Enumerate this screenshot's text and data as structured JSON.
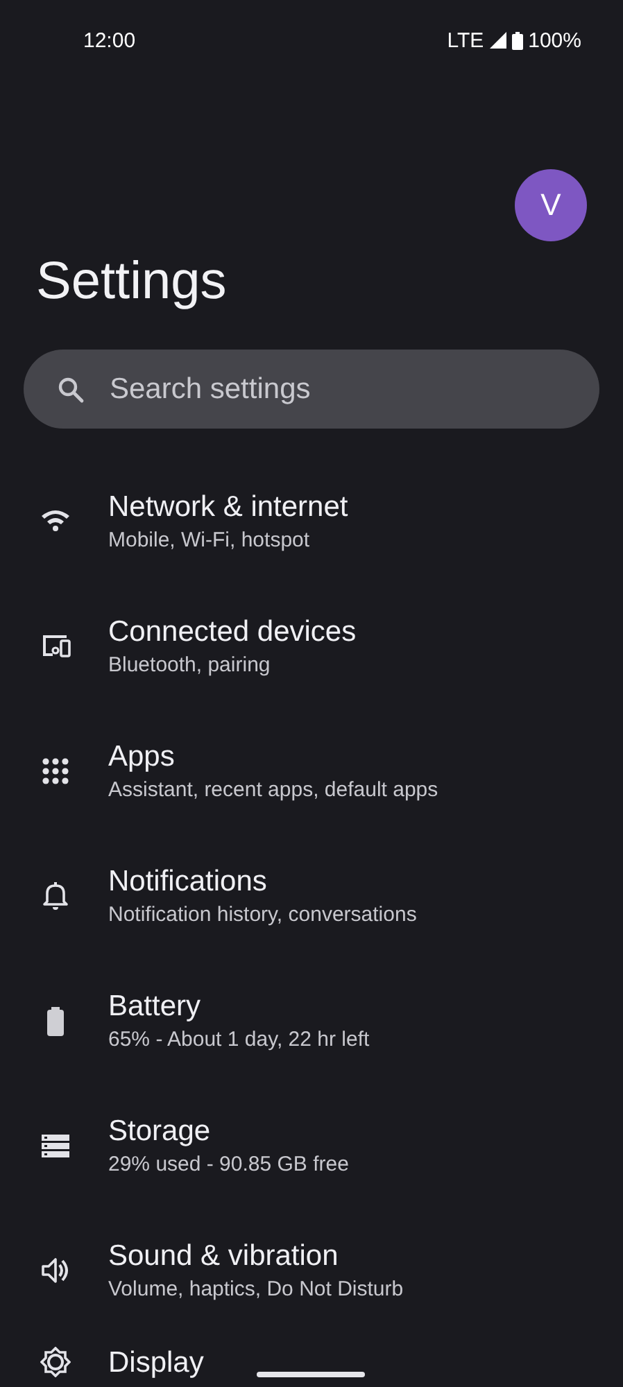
{
  "status_bar": {
    "time": "12:00",
    "network": "LTE",
    "battery": "100%"
  },
  "avatar": {
    "initial": "V",
    "color": "#7e57c2"
  },
  "title": "Settings",
  "search": {
    "placeholder": "Search settings"
  },
  "items": [
    {
      "kind": "wifi",
      "title": "Network & internet",
      "subtitle": "Mobile, Wi-Fi, hotspot"
    },
    {
      "kind": "devices",
      "title": "Connected devices",
      "subtitle": "Bluetooth, pairing"
    },
    {
      "kind": "apps",
      "title": "Apps",
      "subtitle": "Assistant, recent apps, default apps"
    },
    {
      "kind": "bell",
      "title": "Notifications",
      "subtitle": "Notification history, conversations"
    },
    {
      "kind": "battery",
      "title": "Battery",
      "subtitle": "65% - About 1 day, 22 hr left"
    },
    {
      "kind": "storage",
      "title": "Storage",
      "subtitle": "29% used - 90.85 GB free"
    },
    {
      "kind": "sound",
      "title": "Sound & vibration",
      "subtitle": "Volume, haptics, Do Not Disturb"
    },
    {
      "kind": "display",
      "title": "Display"
    }
  ]
}
